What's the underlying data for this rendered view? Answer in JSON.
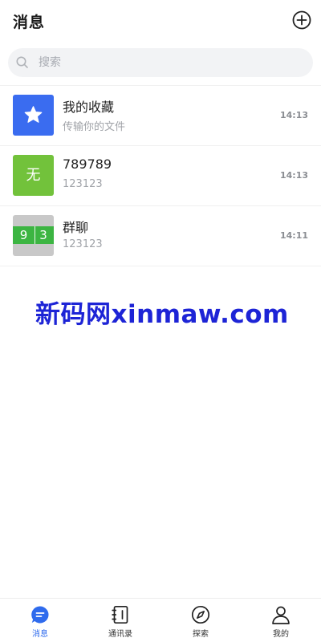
{
  "header": {
    "title": "消息",
    "add_icon": "plus-circle-icon"
  },
  "search": {
    "placeholder": "搜索",
    "value": ""
  },
  "conversations": [
    {
      "name": "我的收藏",
      "preview": "传输你的文件",
      "time": "14:13",
      "avatar_icon": "star-icon",
      "avatar_color": "#3a6cf0"
    },
    {
      "name": "789789",
      "preview": "123123",
      "time": "14:13",
      "avatar_text": "无",
      "avatar_color": "#72c23b"
    },
    {
      "name": "群聊",
      "preview": "123123",
      "time": "14:11",
      "avatar_digits": [
        "9",
        "3"
      ],
      "avatar_color": "#3cb542"
    }
  ],
  "watermark": "新码网xinmaw.com",
  "tabbar": {
    "tabs": [
      {
        "label": "消息",
        "icon": "chat-bubble-icon",
        "active": true
      },
      {
        "label": "通讯录",
        "icon": "contacts-book-icon",
        "active": false
      },
      {
        "label": "探索",
        "icon": "compass-icon",
        "active": false
      },
      {
        "label": "我的",
        "icon": "person-icon",
        "active": false
      }
    ]
  },
  "colors": {
    "accent": "#2f6bed",
    "search_bg": "#f2f3f5",
    "watermark": "#1d24d6"
  }
}
